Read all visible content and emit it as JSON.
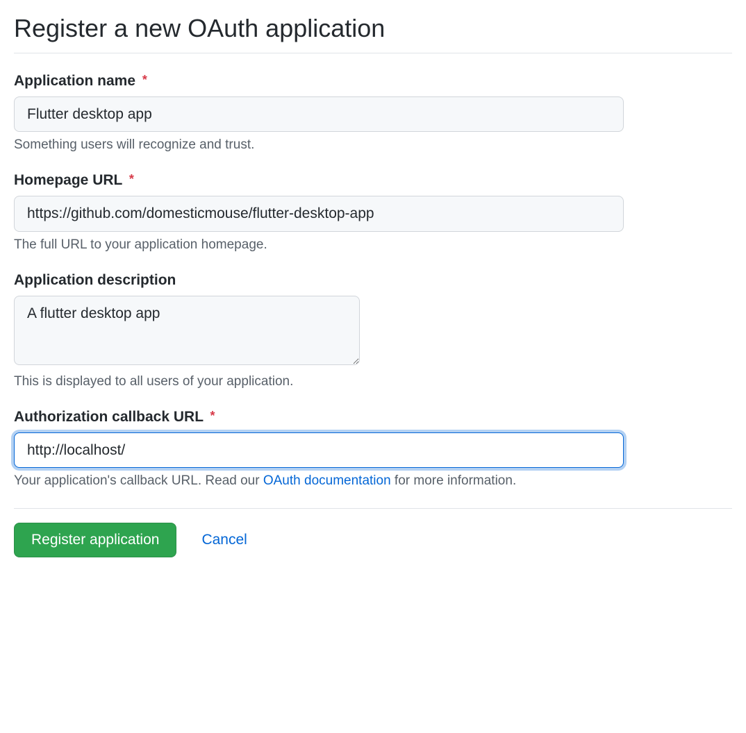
{
  "page": {
    "title": "Register a new OAuth application"
  },
  "form": {
    "app_name": {
      "label": "Application name",
      "required": true,
      "value": "Flutter desktop app",
      "help": "Something users will recognize and trust."
    },
    "homepage_url": {
      "label": "Homepage URL",
      "required": true,
      "value": "https://github.com/domesticmouse/flutter-desktop-app",
      "help": "The full URL to your application homepage."
    },
    "description": {
      "label": "Application description",
      "required": false,
      "value": "A flutter desktop app",
      "help": "This is displayed to all users of your application."
    },
    "callback_url": {
      "label": "Authorization callback URL",
      "required": true,
      "value": "http://localhost/",
      "help_prefix": "Your application's callback URL. Read our ",
      "link_text": "OAuth documentation",
      "help_suffix": " for more information."
    }
  },
  "actions": {
    "register": "Register application",
    "cancel": "Cancel"
  },
  "symbols": {
    "asterisk": "*"
  }
}
